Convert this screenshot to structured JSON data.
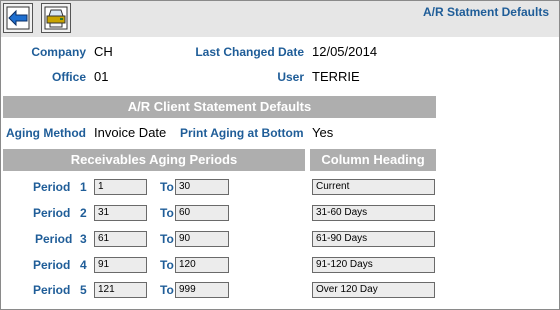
{
  "title": "A/R Statment Defaults",
  "toolbar": {
    "back_icon": "back-arrow-icon",
    "print_icon": "printer-icon"
  },
  "info": {
    "company_label": "Company",
    "company_value": "CH",
    "last_changed_label": "Last Changed Date",
    "last_changed_value": "12/05/2014",
    "office_label": "Office",
    "office_value": "01",
    "user_label": "User",
    "user_value": "TERRIE"
  },
  "client_section": {
    "header": "A/R Client Statement Defaults",
    "aging_method_label": "Aging Method",
    "aging_method_value": "Invoice Date",
    "print_aging_label": "Print Aging at Bottom",
    "print_aging_value": "Yes"
  },
  "aging": {
    "header": "Receivables Aging Periods",
    "column_header": "Column Heading",
    "period_label": "Period",
    "to_label": "To",
    "periods": [
      {
        "num": "1",
        "from": "1",
        "to": "30",
        "heading": "Current"
      },
      {
        "num": "2",
        "from": "31",
        "to": "60",
        "heading": "31-60 Days"
      },
      {
        "num": "3",
        "from": "61",
        "to": "90",
        "heading": "61-90 Days"
      },
      {
        "num": "4",
        "from": "91",
        "to": "120",
        "heading": "91-120 Days"
      },
      {
        "num": "5",
        "from": "121",
        "to": "999",
        "heading": "Over 120 Day"
      }
    ]
  },
  "colors": {
    "accent": "#1f5d98",
    "header_bg": "#aeaeae",
    "toolbar_bg": "#e6e6e6"
  }
}
